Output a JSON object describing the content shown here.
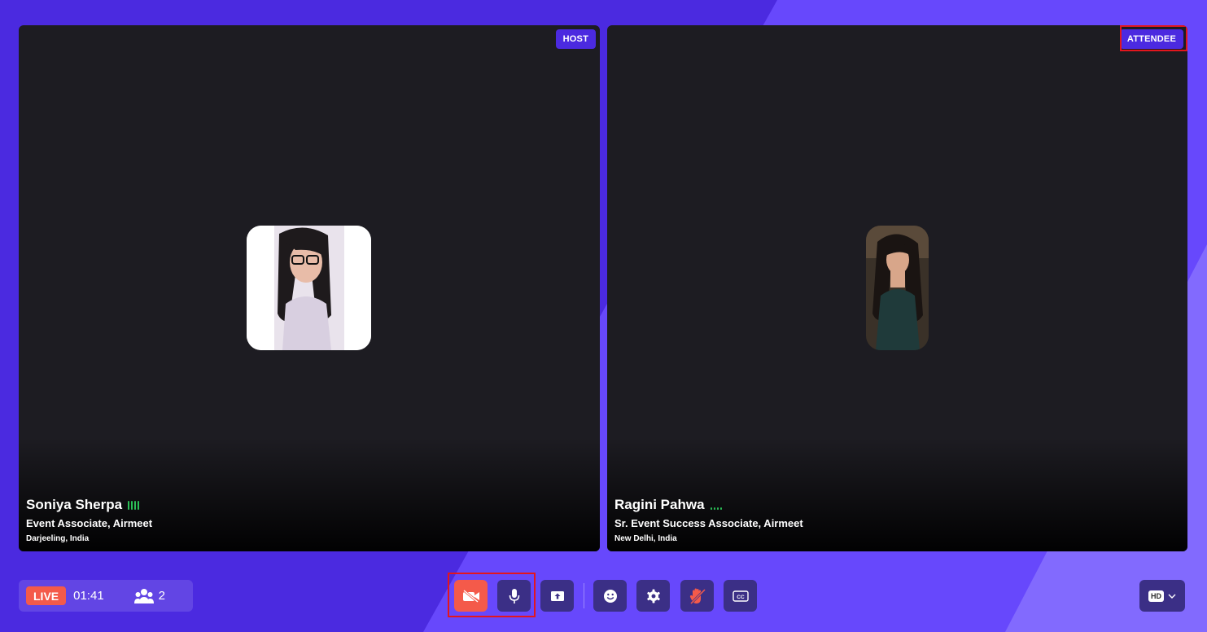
{
  "colors": {
    "background": "#4b2ae0",
    "tile": "#1d1c22",
    "accent_red": "#f45a4a",
    "control": "#3b2f86",
    "audio_green": "#2bbf57",
    "annotation": "#e3161d"
  },
  "tiles": [
    {
      "role": "HOST",
      "name": "Soniya Sherpa",
      "title": "Event Associate, Airmeet",
      "location": "Darjeeling, India"
    },
    {
      "role": "ATTENDEE",
      "name": "Ragini Pahwa",
      "title": "Sr. Event Success Associate, Airmeet",
      "location": "New Delhi, India"
    }
  ],
  "status": {
    "live_label": "LIVE",
    "timer": "01:41",
    "people_count": "2"
  },
  "controls": {
    "camera": "camera-off-icon",
    "mic": "microphone-icon",
    "share": "screen-share-icon",
    "reactions": "smiley-icon",
    "settings": "gear-icon",
    "raise_hand": "hand-off-icon",
    "captions": "cc-icon"
  },
  "quality": {
    "label": "HD"
  }
}
